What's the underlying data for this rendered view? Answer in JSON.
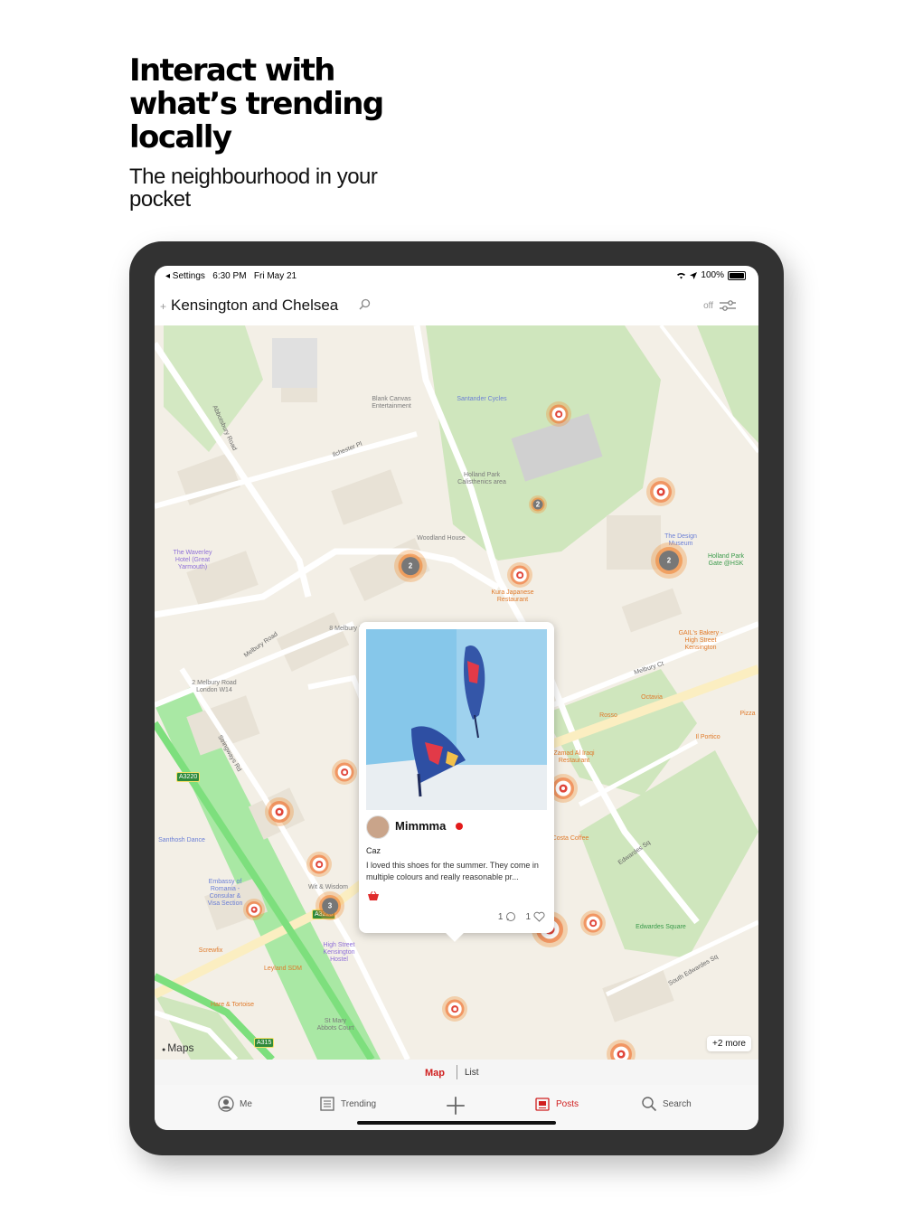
{
  "promo": {
    "headline": "Interact with what’s trending locally",
    "subhead": "The neighbourhood in your pocket"
  },
  "status_bar": {
    "back_label": "◂ Settings",
    "time": "6:30 PM",
    "date": "Fri May 21",
    "battery": "100%"
  },
  "nav": {
    "plus": "+",
    "location_title": "Kensington and Chelsea",
    "filter_state": "off"
  },
  "map": {
    "pois": [
      {
        "label": "Blank Canvas\nEntertainment",
        "color": "gray"
      },
      {
        "label": "Santander Cycles",
        "color": "blue"
      },
      {
        "label": "Holland Park\nCalisthenics area",
        "color": "gray"
      },
      {
        "label": "Woodland House",
        "color": "gray"
      },
      {
        "label": "The Waverley\nHotel (Great\nYarmouth)",
        "color": "purple"
      },
      {
        "label": "Kura Japanese\nRestaurant",
        "color": "orange"
      },
      {
        "label": "The Design\nMuseum",
        "color": "blue"
      },
      {
        "label": "Holland Park\nGate @HSK",
        "color": "green"
      },
      {
        "label": "8 Melbury Road",
        "color": "gray"
      },
      {
        "label": "GAIL's Bakery -\nHigh Street\nKensington",
        "color": "orange"
      },
      {
        "label": "2 Melbury Road\nLondon W14",
        "color": "gray"
      },
      {
        "label": "Octavia",
        "color": "orange"
      },
      {
        "label": "Rosso",
        "color": "orange"
      },
      {
        "label": "Pizza",
        "color": "orange"
      },
      {
        "label": "Il Portico",
        "color": "orange"
      },
      {
        "label": "Zamad Al Iraqi\nRestaurant",
        "color": "orange"
      },
      {
        "label": "Santhosh Dance",
        "color": "blue"
      },
      {
        "label": "Costa Coffee",
        "color": "orange"
      },
      {
        "label": "Embassy of\nRomania -\nConsular &\nVisa Section",
        "color": "blue"
      },
      {
        "label": "Wit & Wisdom",
        "color": "gray"
      },
      {
        "label": "Edwardes Square",
        "color": "green"
      },
      {
        "label": "Screwfix",
        "color": "orange"
      },
      {
        "label": "High Street\nKensington\nHostel",
        "color": "purple"
      },
      {
        "label": "Leyland SDM",
        "color": "orange"
      },
      {
        "label": "Hare & Tortoise",
        "color": "orange"
      },
      {
        "label": "St Mary\nAbbots Court",
        "color": "gray"
      }
    ],
    "roads": [
      "Abbotsbury Road",
      "Ilchester Pl",
      "Melbury Road",
      "Melbury Ct",
      "Stringways Rd",
      "Edwardes Sq",
      "South Edwardes Sq"
    ],
    "road_shields": [
      "A3220",
      "A3220",
      "A315"
    ],
    "markers": [
      {
        "count": ""
      },
      {
        "count": ""
      },
      {
        "count": "2"
      },
      {
        "count": "2"
      },
      {
        "count": ""
      },
      {
        "count": "2"
      },
      {
        "count": ""
      },
      {
        "count": ""
      },
      {
        "count": ""
      },
      {
        "count": ""
      },
      {
        "count": ""
      },
      {
        "count": "3"
      },
      {
        "count": ""
      },
      {
        "count": ""
      },
      {
        "count": ""
      },
      {
        "count": ""
      },
      {
        "count": ""
      }
    ],
    "attribution": "Maps",
    "more_badge": "+2 more"
  },
  "post": {
    "username": "Mimmma",
    "author": "Caz",
    "caption": "I loved this shoes for the summer. They come in multiple colours and really reasonable pr...",
    "comments": "1",
    "likes": "1"
  },
  "segment": {
    "map_label": "Map",
    "list_label": "List"
  },
  "tabs": {
    "me": "Me",
    "trending": "Trending",
    "posts": "Posts",
    "search": "Search"
  },
  "colors": {
    "accent": "#d01f1f",
    "park": "#cfe6bd",
    "marker_orange": "#f0a24a",
    "marker_red": "#e0453a"
  }
}
